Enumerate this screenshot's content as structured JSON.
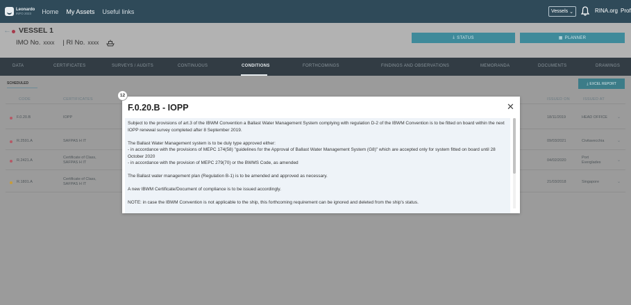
{
  "topbar": {
    "logo_line1": "Leonardo",
    "logo_line2": "INFO 2023",
    "nav": [
      {
        "label": "Home",
        "active": false
      },
      {
        "label": "My Assets",
        "active": true
      },
      {
        "label": "Useful links",
        "active": false
      }
    ],
    "vessels_select": "Vessels",
    "rina_link": "RINA.org",
    "profile_link": "Profile"
  },
  "header": {
    "back_icon": "arrow-left-icon",
    "vessel_name": "VESSEL 1",
    "imo_label": "IMO No.",
    "imo_value": "xxxx",
    "ri_label": "| RI No.",
    "ri_value": "xxxx",
    "status_button": "STATUS",
    "planner_button": "PLANNER"
  },
  "tabs": [
    {
      "label": "DATA",
      "active": false
    },
    {
      "label": "CERTIFICATES",
      "active": false
    },
    {
      "label": "SURVEYS / AUDITS",
      "active": false
    },
    {
      "label": "CONTINUOUS",
      "active": false
    },
    {
      "label": "CONDITIONS",
      "active": true
    },
    {
      "label": "FORTHCOMINGS",
      "active": false
    },
    {
      "label": "FINDINGS AND OBSERVATIONS",
      "active": false
    },
    {
      "label": "MEMORANDA",
      "active": false
    },
    {
      "label": "DOCUMENTS",
      "active": false
    },
    {
      "label": "DRAWINGS",
      "active": false
    }
  ],
  "conditions": {
    "subtab": "SCHEDULED",
    "excel_button": "EXCEL REPORT",
    "columns": {
      "code": "CODE",
      "certificates": "CERTIFICATES",
      "issued_on": "ISSUED ON",
      "issued_at": "ISSUED AT"
    },
    "rows": [
      {
        "code": "F.0.20.B",
        "certificate": "IOPP",
        "issued_on": "18/11/2019",
        "issued_at": "HEAD OFFICE",
        "dot_color": "#b55a66"
      },
      {
        "code": "R.2591.A",
        "certificate": "SAFPAS H IT",
        "issued_on": "09/03/2021",
        "issued_at": "Civitavecchia",
        "dot_color": "#b55a66"
      },
      {
        "code": "R.2421.A",
        "certificate": "Certificate of Class, SAFPAS H IT",
        "issued_on": "04/02/2020",
        "issued_at": "Port Everglades",
        "dot_color": "#b55a66"
      },
      {
        "code": "R.1801.A",
        "certificate": "Certificate of Class, SAFPAS H IT",
        "issued_on": "21/03/2018",
        "issued_at": "Singapore",
        "dot_color": "#c79c3a"
      }
    ]
  },
  "badge": "12",
  "modal": {
    "title": "F.0.20.B - IOPP",
    "close_icon": "close-icon",
    "paragraphs": [
      "Subject to the provisions of art.3 of the IBWM Convention a Ballast Water Management System complying with regulation D-2 of the IBWM Convention is to be fitted on board within the next IOPP renewal survey completed after 8 September 2019.",
      "The Ballast Water Management system is to be duly type approved either:",
      "The Ballast water management plan (Regulation B-1) is to be amended and approved as necessary.",
      "A new IBWM Certificate/Document of compliance is to be issued accordingly.",
      "NOTE: in case the IBWM Convention is not applicable to the ship, this forthcoming requirement can be ignored and deleted from the ship's status."
    ],
    "bullet1": "- in accordance with the provisions of MEPC 174(58) \"guidelines for the Approval of Ballast Water Management System (G8)\" which are accepted only for system fitted on board until 28 October 2020",
    "bullet2": "- in accordance with the provision of MEPC 279(70) or the BWMS Code, as amended"
  }
}
